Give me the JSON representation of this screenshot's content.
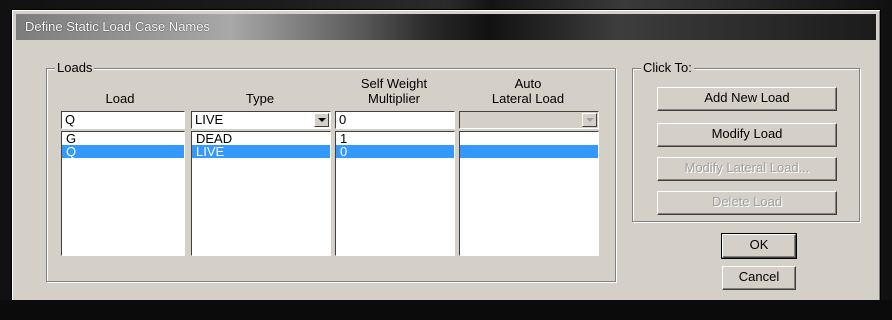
{
  "window": {
    "title": "Define Static Load Case Names"
  },
  "loads_group": {
    "legend": "Loads",
    "headers": {
      "load": "Load",
      "type": "Type",
      "self_weight_line1": "Self Weight",
      "self_weight_line2": "Multiplier",
      "auto_line1": "Auto",
      "auto_line2": "Lateral Load"
    },
    "edit": {
      "load": "Q",
      "type": "LIVE",
      "self_weight": "0",
      "auto_lateral": ""
    },
    "rows": [
      {
        "load": "G",
        "type": "DEAD",
        "self_weight": "1",
        "auto_lateral": ""
      },
      {
        "load": "Q",
        "type": "LIVE",
        "self_weight": "0",
        "auto_lateral": ""
      }
    ],
    "selected_row": 1
  },
  "click_to_group": {
    "legend": "Click To:",
    "add_new_load": "Add New Load",
    "modify_load": "Modify Load",
    "modify_lateral_load": "Modify Lateral Load...",
    "delete_load": "Delete Load"
  },
  "dialog_buttons": {
    "ok": "OK",
    "cancel": "Cancel"
  },
  "icons": {
    "dropdown": "chevron-down-icon"
  }
}
